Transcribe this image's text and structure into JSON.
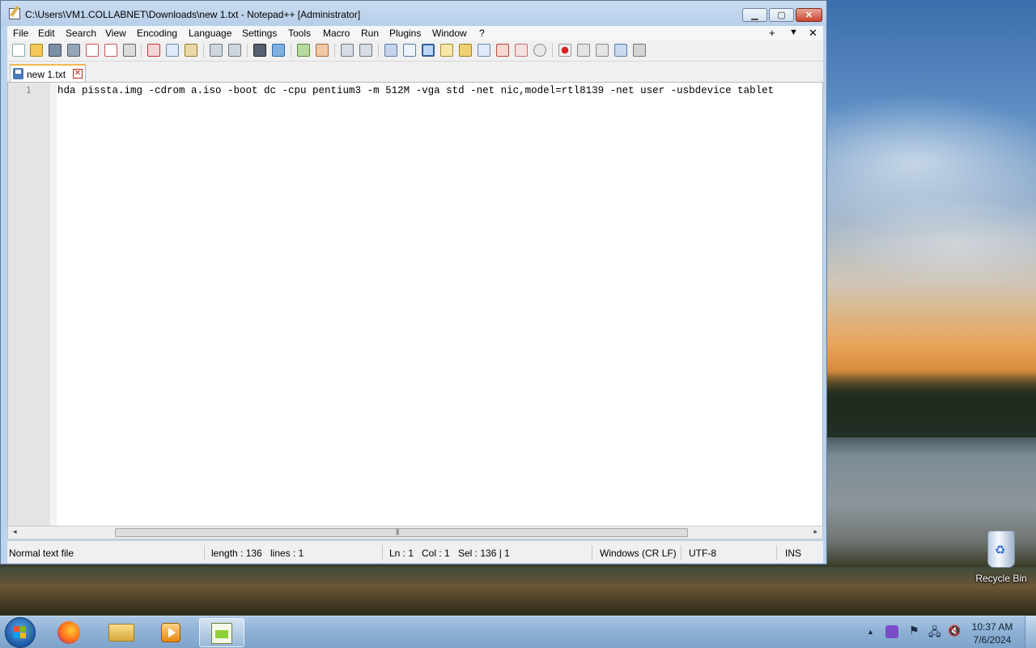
{
  "window": {
    "title": "C:\\Users\\VM1.COLLABNET\\Downloads\\new 1.txt - Notepad++ [Administrator]",
    "min_glyph": "▁",
    "max_glyph": "▢",
    "close_glyph": "✕"
  },
  "menu": {
    "items": [
      "File",
      "Edit",
      "Search",
      "View",
      "Encoding",
      "Language",
      "Settings",
      "Tools",
      "Macro",
      "Run",
      "Plugins",
      "Window",
      "?"
    ],
    "right": [
      "+",
      "▼",
      "✕"
    ]
  },
  "toolbar": {
    "icons": [
      "new-file-icon",
      "open-file-icon",
      "save-icon",
      "save-all-icon",
      "close-icon",
      "close-all-icon",
      "print-icon",
      "cut-icon",
      "copy-icon",
      "paste-icon",
      "undo-icon",
      "redo-icon",
      "find-icon",
      "replace-icon",
      "zoom-in-icon",
      "zoom-out-icon",
      "sync-vertical-icon",
      "sync-horizontal-icon",
      "word-wrap-icon",
      "show-all-characters-icon",
      "indent-guide-icon",
      "user-language-icon",
      "document-map-icon",
      "function-list-icon",
      "folder-as-workspace-icon",
      "monitoring-icon",
      "record-macro-icon",
      "stop-recording-icon",
      "playback-macro-icon",
      "run-macro-multiple-icon",
      "save-macro-icon"
    ]
  },
  "tab": {
    "label": "new 1.txt",
    "close_glyph": "✕"
  },
  "editor": {
    "line_number": "1",
    "line_text": "hda pissta.img -cdrom a.iso -boot dc -cpu pentium3 -m 512M -vga std -net nic,model=rtl8139 -net user -usbdevice tablet"
  },
  "scrollbar": {
    "left_arrow": "◂",
    "right_arrow": "▸",
    "grip": "|||"
  },
  "status": {
    "file_type": "Normal text file",
    "length": "length : 136",
    "lines": "lines : 1",
    "ln": "Ln : 1",
    "col": "Col : 1",
    "sel": "Sel : 136 | 1",
    "eol": "Windows (CR LF)",
    "encoding": "UTF-8",
    "mode": "INS"
  },
  "desktop": {
    "recycle_bin_label": "Recycle Bin"
  },
  "taskbar": {
    "apps": [
      "firefox-icon",
      "file-explorer-icon",
      "media-player-icon",
      "notepad-plus-plus-icon"
    ],
    "tray_glyphs": {
      "chevron": "▲",
      "flag": "⚑",
      "network": "🖧",
      "volume": "🔇"
    },
    "time": "10:37 AM",
    "date": "7/6/2024"
  },
  "colors": {
    "title_bar": "#c9dcf1",
    "close_button": "#c8452f",
    "tab_accent": "#f2b74d",
    "taskbar": "#8fb2d6"
  }
}
